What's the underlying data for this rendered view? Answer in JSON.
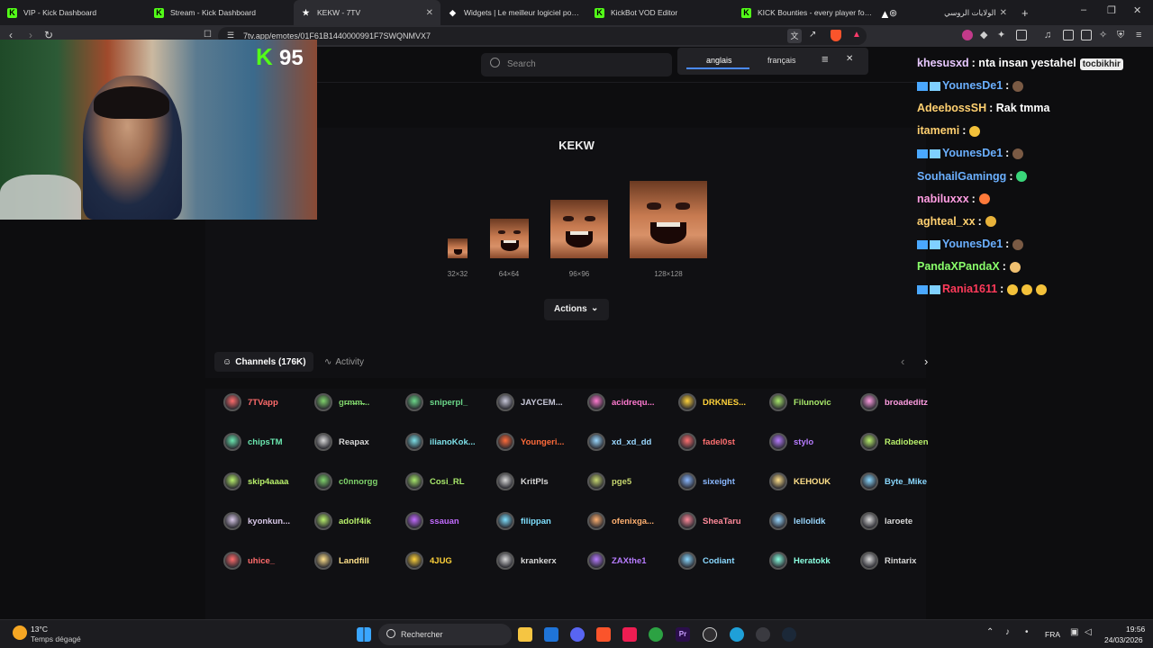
{
  "browser": {
    "tabs": [
      {
        "label": "VIP - Kick Dashboard",
        "active": false
      },
      {
        "label": "Stream - Kick Dashboard",
        "active": false
      },
      {
        "label": "KEKW - 7TV",
        "active": true
      },
      {
        "label": "Widgets | Le meilleur logiciel pour b",
        "active": false
      },
      {
        "label": "KickBot VOD Editor",
        "active": false
      },
      {
        "label": "KICK Bounties - every player for the",
        "active": false
      },
      {
        "label": "الولايات الروسي",
        "active": false
      }
    ],
    "url": "7tv.app/emotes/01F61B1440000991F7SWQNMVX7",
    "new_tab_symbol": "+"
  },
  "site": {
    "search_placeholder": "Search",
    "translate": {
      "lang_a": "anglais",
      "lang_b": "français"
    },
    "emote": {
      "name": "KEKW",
      "sizes": [
        "32×32",
        "64×64",
        "96×96",
        "128×128"
      ],
      "actions_label": "Actions"
    },
    "tabs": {
      "channels": "Channels (176K)",
      "activity": "Activity"
    },
    "channels": [
      {
        "name": "7TVapp",
        "color": "#ff6b6b"
      },
      {
        "name": "gr̶m̶m̶...",
        "color": "#7fd36b"
      },
      {
        "name": "sniperpl_",
        "color": "#6cd98a"
      },
      {
        "name": "JAYCEM...",
        "color": "#c7c7d8"
      },
      {
        "name": "acidrequ...",
        "color": "#ff7ad0"
      },
      {
        "name": "DRKNES...",
        "color": "#ffd23a"
      },
      {
        "name": "Filunovic",
        "color": "#a8e86b"
      },
      {
        "name": "broadeditz",
        "color": "#ff9de2"
      },
      {
        "name": "chipsTM",
        "color": "#6be8b0"
      },
      {
        "name": "Reapax",
        "color": "#d8d8d8"
      },
      {
        "name": "ilianoKok...",
        "color": "#7de0e8"
      },
      {
        "name": "Youngeri...",
        "color": "#ff6b3a"
      },
      {
        "name": "xd_xd_dd",
        "color": "#9ad8ff"
      },
      {
        "name": "fadel0st",
        "color": "#ff7070"
      },
      {
        "name": "stylo",
        "color": "#b77cff"
      },
      {
        "name": "Radiobeen",
        "color": "#b8f06b"
      },
      {
        "name": "skip4aaaa",
        "color": "#b8f06b"
      },
      {
        "name": "c0nnorgg",
        "color": "#7fd36b"
      },
      {
        "name": "Cosi_RL",
        "color": "#a8e86b"
      },
      {
        "name": "KritPls",
        "color": "#d8d8d8"
      },
      {
        "name": "pge5",
        "color": "#c8d870"
      },
      {
        "name": "sixeight",
        "color": "#8ab8ff"
      },
      {
        "name": "KEHOUK",
        "color": "#ffe08a"
      },
      {
        "name": "Byte_Mike",
        "color": "#8ad8ff"
      },
      {
        "name": "kyonkun...",
        "color": "#d8c8e8"
      },
      {
        "name": "adolf4ik",
        "color": "#b8f06b"
      },
      {
        "name": "ssauan",
        "color": "#c26bff"
      },
      {
        "name": "filippan",
        "color": "#7fe0ff"
      },
      {
        "name": "ofenixga...",
        "color": "#ffb070"
      },
      {
        "name": "SheaTaru",
        "color": "#ff8a9a"
      },
      {
        "name": "lellolidk",
        "color": "#9ad8ff"
      },
      {
        "name": "laroete",
        "color": "#d8d8d8"
      },
      {
        "name": "uhice_",
        "color": "#ff6b6b"
      },
      {
        "name": "Landfill",
        "color": "#ffe08a"
      },
      {
        "name": "4JUG",
        "color": "#ffd23a"
      },
      {
        "name": "krankerx",
        "color": "#d8d8d8"
      },
      {
        "name": "ZAXthe1",
        "color": "#b77cff"
      },
      {
        "name": "Codiant",
        "color": "#8ad8ff"
      },
      {
        "name": "Heratokk",
        "color": "#8affe0"
      },
      {
        "name": "Rintarix",
        "color": "#d8d8d8"
      }
    ]
  },
  "overlay": {
    "kick_count": "95"
  },
  "chat": [
    {
      "user": "khesusxd",
      "msg": ": nta insan yestahel",
      "color": "#e8c8ff",
      "badge": false,
      "emotes": [],
      "tag": "tocbikhir"
    },
    {
      "user": "YounesDe1",
      "msg": ":",
      "color": "#6bb0ff",
      "badge": true,
      "emotes": [
        "#7a5a44"
      ]
    },
    {
      "user": "AdeebossSH",
      "msg": ": Rak tmma",
      "color": "#ffd070",
      "badge": false,
      "emotes": []
    },
    {
      "user": "itamemi",
      "msg": ":",
      "color": "#ffd070",
      "badge": false,
      "emotes": [
        "#f3c13a"
      ]
    },
    {
      "user": "YounesDe1",
      "msg": ":",
      "color": "#6bb0ff",
      "badge": true,
      "emotes": [
        "#7a5a44"
      ]
    },
    {
      "user": "SouhailGamingg",
      "msg": ":",
      "color": "#6bb0ff",
      "badge": false,
      "emotes": [
        "#3ad67a"
      ]
    },
    {
      "user": "nabiluxxx",
      "msg": ":",
      "color": "#ff9de2",
      "badge": false,
      "emotes": [
        "#ff7a3a"
      ]
    },
    {
      "user": "aghteal_xx",
      "msg": ":",
      "color": "#ffd070",
      "badge": false,
      "emotes": [
        "#e8b23a"
      ]
    },
    {
      "user": "YounesDe1",
      "msg": ":",
      "color": "#6bb0ff",
      "badge": true,
      "emotes": [
        "#7a5a44"
      ]
    },
    {
      "user": "PandaXPandaX",
      "msg": ":",
      "color": "#8aff6b",
      "badge": false,
      "emotes": [
        "#f0c070"
      ]
    },
    {
      "user": "Rania1611",
      "msg": ":",
      "color": "#ff3a5a",
      "badge": true,
      "emotes": [
        "#f3c13a",
        "#f3c13a",
        "#f3c13a"
      ]
    }
  ],
  "taskbar": {
    "weather_temp": "13°C",
    "weather_desc": "Temps dégagé",
    "search_label": "Rechercher",
    "language": "FRA",
    "time": "19:56",
    "date": "24/03/2026"
  }
}
